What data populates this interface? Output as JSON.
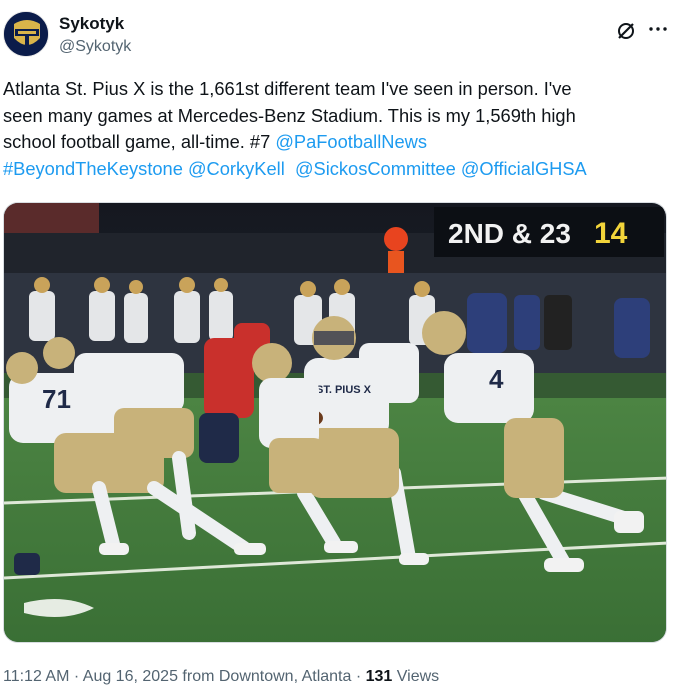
{
  "author": {
    "name": "Sykotyk",
    "handle": "@Sykotyk",
    "avatar_colors": {
      "bg": "#0b1c4a",
      "gold": "#d9b44a"
    }
  },
  "icons": {
    "grok": "grok-slash-circle-icon",
    "more": "more-dots-icon"
  },
  "tweet": {
    "line1": "Atlanta St. Pius X is the 1,661st different team I've seen in person. I've",
    "line2": "seen many games at Mercedes-Benz Stadium. This is my 1,569th high",
    "line3_text": "school football game, all-time. #7 ",
    "mention_pafootballnews": "@PaFootballNews",
    "hashtag_beyond": "#BeyondTheKeystone",
    "mention_corkykell": "@CorkyKell",
    "mention_sickos": "@SickosCommittee",
    "mention_ghsa": "@OfficialGHSA"
  },
  "photo": {
    "scoreboard_down": "2ND & 23",
    "scoreboard_number": "14",
    "jersey_qb": "ST. PIUS X",
    "jersey_number_left": "71",
    "jersey_number_right": "4",
    "colors": {
      "turf": "#3f7a3a",
      "gold": "#c8b27a",
      "white_jersey": "#eef0f2",
      "red_jersey": "#c9302c",
      "navy": "#1f2a48"
    }
  },
  "footer": {
    "time": "11:12 AM",
    "sep1": " · ",
    "date": "Aug 16, 2025",
    "location": " from Downtown, Atlanta",
    "sep2": " · ",
    "views_count": "131",
    "views_label": " Views"
  }
}
